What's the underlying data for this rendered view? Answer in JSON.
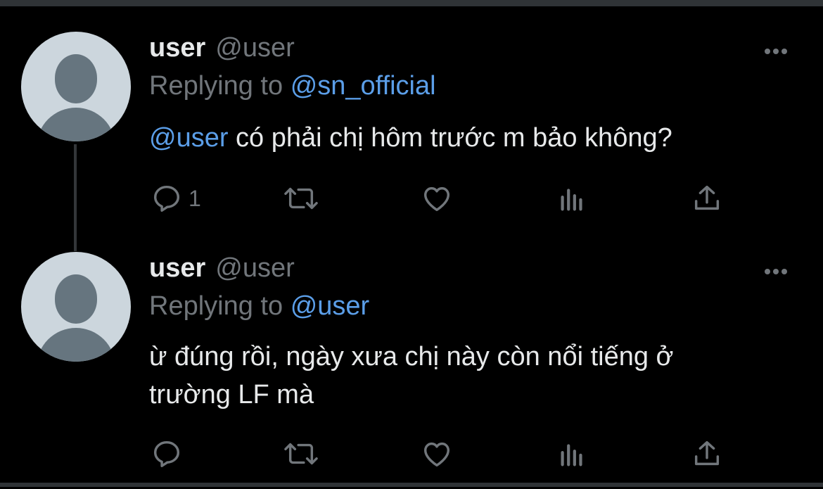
{
  "colors": {
    "background": "#000000",
    "divider": "#2f3336",
    "text_primary": "#e7e9ea",
    "text_secondary": "#71767b",
    "link": "#5b9ee8",
    "avatar_bg": "#ccd6dd",
    "avatar_fg": "#66757f"
  },
  "tweets": [
    {
      "display_name": "user",
      "handle": "@user",
      "replying_prefix": "Replying to",
      "replying_to": "@sn_official",
      "mention": "@user",
      "text": " có phải chị hôm trước m bảo không?",
      "actions": {
        "reply_count": "1",
        "icons": [
          "reply-icon",
          "retweet-icon",
          "like-icon",
          "views-icon",
          "share-icon"
        ]
      }
    },
    {
      "display_name": "user",
      "handle": "@user",
      "replying_prefix": "Replying to",
      "replying_to": "@user",
      "text_line1": "ừ đúng rồi, ngày xưa chị này còn nổi tiếng ở",
      "text_line2": "trường LF mà",
      "actions": {
        "reply_count": "",
        "icons": [
          "reply-icon",
          "retweet-icon",
          "like-icon",
          "views-icon",
          "share-icon"
        ]
      }
    }
  ]
}
